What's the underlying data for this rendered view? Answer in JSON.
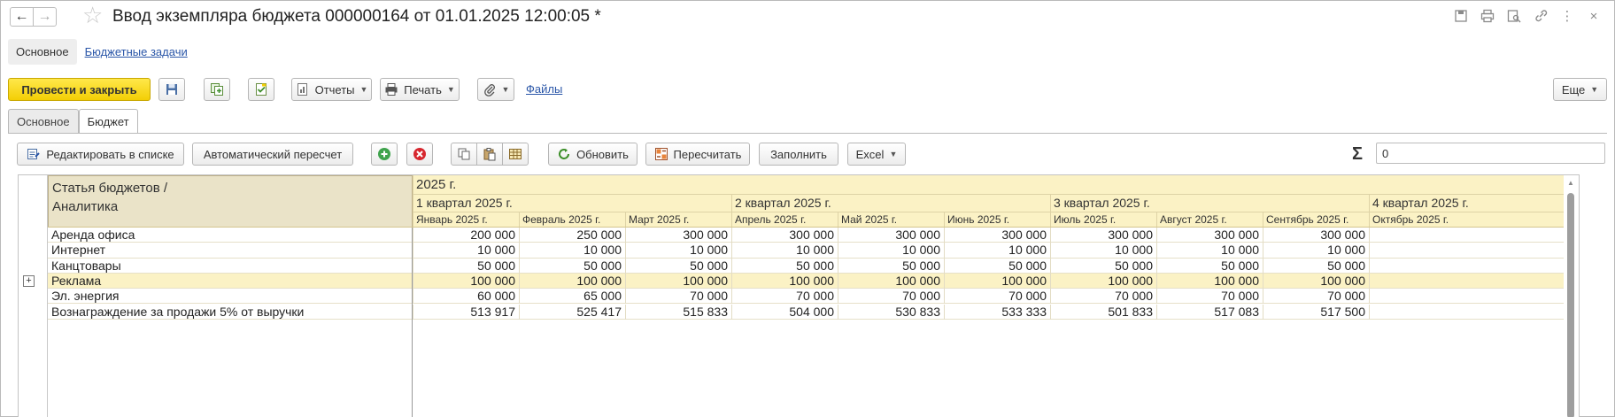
{
  "window": {
    "title": "Ввод экземпляра бюджета 000000164 от 01.01.2025 12:00:05 *",
    "tool_icons": [
      "save-icon",
      "print-icon",
      "preview-icon",
      "link-icon",
      "more-vertical-icon",
      "close-icon"
    ]
  },
  "sections": {
    "active": "Основное",
    "link": "Бюджетные задачи"
  },
  "toolbar": {
    "post_close": "Провести и закрыть",
    "reports": "Отчеты",
    "print": "Печать",
    "files": "Файлы",
    "more": "Еще"
  },
  "form_tabs": [
    "Основное",
    "Бюджет"
  ],
  "grid_toolbar": {
    "edit_list": "Редактировать в списке",
    "auto_recalc": "Автоматический пересчет",
    "refresh": "Обновить",
    "recalc": "Пересчитать",
    "fill": "Заполнить",
    "excel": "Excel",
    "sum_symbol": "Σ",
    "sum_value": "0"
  },
  "grid": {
    "name_header_line1": "Статья бюджетов /",
    "name_header_line2": "Аналитика",
    "year": "2025 г.",
    "quarters": [
      "1 квартал 2025 г.",
      "2 квартал 2025 г.",
      "3 квартал 2025 г.",
      "4 квартал 2025 г."
    ],
    "months": [
      "Январь 2025 г.",
      "Февраль 2025 г.",
      "Март 2025 г.",
      "Апрель 2025 г.",
      "Май 2025 г.",
      "Июнь 2025 г.",
      "Июль 2025 г.",
      "Август 2025 г.",
      "Сентябрь 2025 г.",
      "Октябрь 2025 г."
    ],
    "rows": [
      {
        "name": "Аренда офиса",
        "values": [
          "200 000",
          "250 000",
          "300 000",
          "300 000",
          "300 000",
          "300 000",
          "300 000",
          "300 000",
          "300 000",
          ""
        ]
      },
      {
        "name": "Интернет",
        "values": [
          "10 000",
          "10 000",
          "10 000",
          "10 000",
          "10 000",
          "10 000",
          "10 000",
          "10 000",
          "10 000",
          ""
        ]
      },
      {
        "name": "Канцтовары",
        "values": [
          "50 000",
          "50 000",
          "50 000",
          "50 000",
          "50 000",
          "50 000",
          "50 000",
          "50 000",
          "50 000",
          ""
        ]
      },
      {
        "name": "Реклама",
        "values": [
          "100 000",
          "100 000",
          "100 000",
          "100 000",
          "100 000",
          "100 000",
          "100 000",
          "100 000",
          "100 000",
          ""
        ],
        "selected": true,
        "expandable": true,
        "expander": "+"
      },
      {
        "name": "Эл. энергия",
        "values": [
          "60 000",
          "65 000",
          "70 000",
          "70 000",
          "70 000",
          "70 000",
          "70 000",
          "70 000",
          "70 000",
          ""
        ]
      },
      {
        "name": "Вознаграждение  за продажи 5% от выручки",
        "values": [
          "513 917",
          "525 417",
          "515 833",
          "504 000",
          "530 833",
          "533 333",
          "501 833",
          "517 083",
          "517 500",
          ""
        ]
      }
    ]
  },
  "colors": {
    "accent_yellow": "#f3ce05",
    "header_bg": "#fbf2c5",
    "name_header_bg": "#eae3c8",
    "link": "#2a56a8"
  }
}
